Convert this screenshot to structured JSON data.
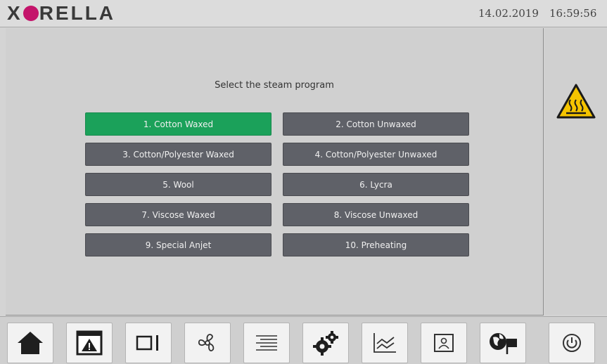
{
  "header": {
    "logo_text": "XORELLA",
    "date": "14.02.2019",
    "time": "16:59:56"
  },
  "main": {
    "prompt": "Select the steam program",
    "programs": [
      {
        "label": "1. Cotton Waxed",
        "selected": true
      },
      {
        "label": "2. Cotton Unwaxed",
        "selected": false
      },
      {
        "label": "3. Cotton/Polyester Waxed",
        "selected": false
      },
      {
        "label": "4. Cotton/Polyester Unwaxed",
        "selected": false
      },
      {
        "label": "5. Wool",
        "selected": false
      },
      {
        "label": "6. Lycra",
        "selected": false
      },
      {
        "label": "7. Viscose Waxed",
        "selected": false
      },
      {
        "label": "8. Viscose Unwaxed",
        "selected": false
      },
      {
        "label": "9. Special Anjet",
        "selected": false
      },
      {
        "label": "10. Preheating",
        "selected": false
      }
    ],
    "selected_color": "#1ba15a",
    "button_color": "#5f6168"
  },
  "sidebar": {
    "warning_icon": "hot-surface-warning-icon",
    "warning_color": "#f5c400"
  },
  "footer": {
    "buttons": [
      {
        "name": "home",
        "icon": "home-icon"
      },
      {
        "name": "alarms",
        "icon": "alarm-window-icon"
      },
      {
        "name": "view",
        "icon": "panel-icon"
      },
      {
        "name": "fan",
        "icon": "fan-icon"
      },
      {
        "name": "list",
        "icon": "list-icon"
      },
      {
        "name": "settings",
        "icon": "gears-icon"
      },
      {
        "name": "chart",
        "icon": "chart-icon"
      },
      {
        "name": "user",
        "icon": "user-icon"
      },
      {
        "name": "language",
        "icon": "globe-flag-icon"
      },
      {
        "name": "power",
        "icon": "power-icon"
      }
    ]
  }
}
